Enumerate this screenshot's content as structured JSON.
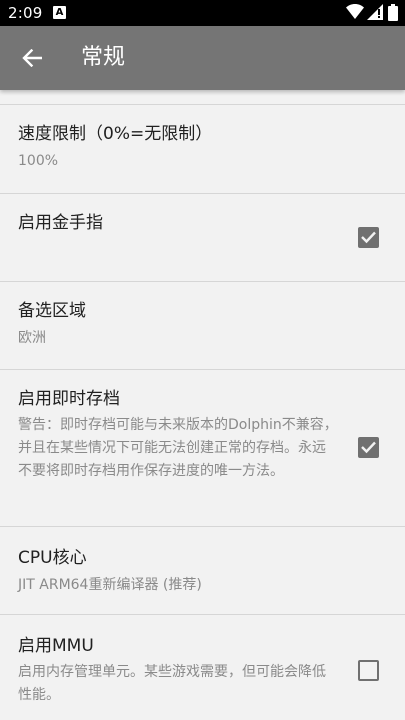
{
  "status_bar": {
    "time": "2:09",
    "notification_icon": "A"
  },
  "app_bar": {
    "title": "常规",
    "back_icon": "arrow-left-icon"
  },
  "settings": [
    {
      "title": "速度限制（0%=无限制）",
      "summary": "100%"
    },
    {
      "title": "启用金手指",
      "checked": true
    },
    {
      "title": "备选区域",
      "summary": "欧洲"
    },
    {
      "title": "启用即时存档",
      "summary": "警告：即时存档可能与未来版本的Dolphin不兼容，并且在某些情况下可能无法创建正常的存档。永远不要将即时存档用作保存进度的唯一方法。",
      "checked": true
    },
    {
      "title": "CPU核心",
      "summary": "JIT ARM64重新编译器 (推荐)"
    },
    {
      "title": "启用MMU",
      "summary": "启用内存管理单元。某些游戏需要，但可能会降低性能。",
      "checked": false
    }
  ],
  "colors": {
    "app_bar": "#757575",
    "background": "#f2f2f2",
    "checkbox": "#707070"
  }
}
